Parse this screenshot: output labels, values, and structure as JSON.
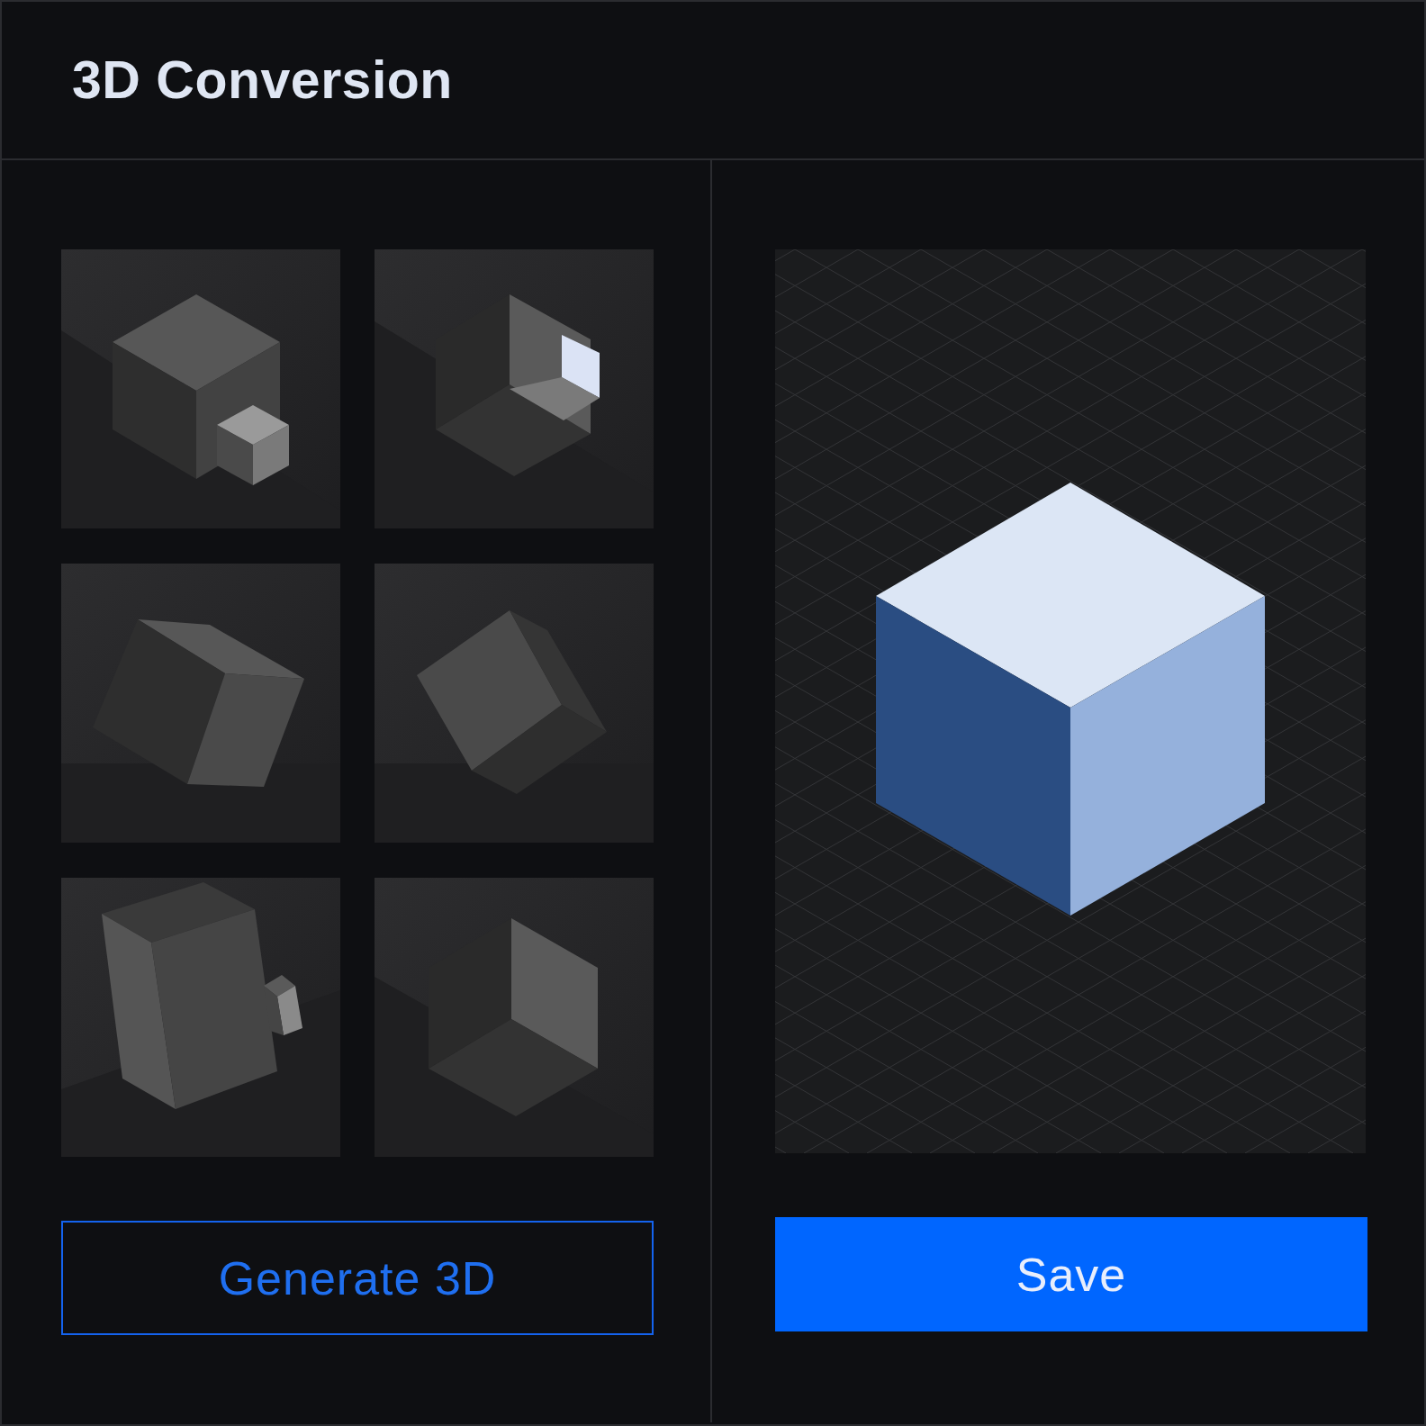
{
  "header": {
    "title": "3D Conversion"
  },
  "buttons": [
    {
      "kind": "outline",
      "label": "Generate 3D"
    },
    {
      "kind": "primary",
      "label": "Save"
    }
  ]
}
